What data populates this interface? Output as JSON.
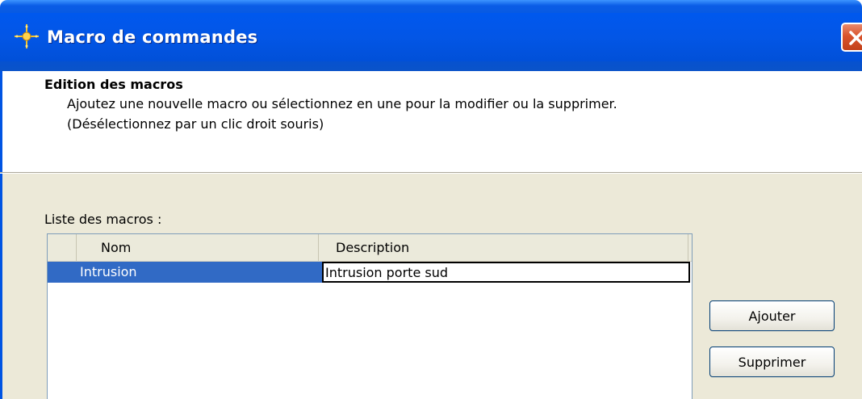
{
  "window": {
    "title": "Macro de commandes"
  },
  "header": {
    "title": "Edition des macros",
    "description_line1": "Ajoutez une nouvelle macro ou sélectionnez en une pour la modifier ou la supprimer.",
    "description_line2": "(Désélectionnez par un clic droit souris)"
  },
  "list": {
    "label": "Liste des macros :",
    "columns": [
      "Nom",
      "Description"
    ],
    "rows": [
      {
        "nom": "Intrusion",
        "description": "Intrusion porte sud",
        "selected": true
      }
    ]
  },
  "buttons": {
    "add_label": "Ajouter",
    "delete_label": "Supprimer"
  },
  "icons": {
    "title_icon": "macro-sparkle-icon",
    "close_icon": "close-icon"
  },
  "colors": {
    "titlebar": "#0054e3",
    "selection": "#316ac5",
    "dialog_face": "#ece9d8",
    "close_button": "#d9532c"
  }
}
